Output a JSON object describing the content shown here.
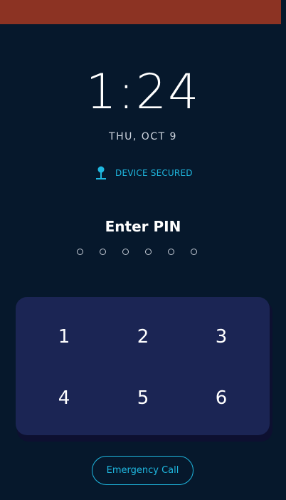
{
  "status_bar": {
    "color": "#8c3323"
  },
  "lock_screen": {
    "time": "1:24",
    "date": "THU, OCT 9",
    "secured_icon": "pin-icon",
    "secured_label": "DEVICE SECURED",
    "prompt": "Enter PIN",
    "pin_length": 6,
    "pin_entered": 0
  },
  "keypad": {
    "keys": [
      "1",
      "2",
      "3",
      "4",
      "5",
      "6"
    ]
  },
  "emergency": {
    "label": "Emergency Call"
  },
  "colors": {
    "background": "#06182c",
    "accent": "#1fb8e0",
    "keypad": "#1b2554",
    "status_bar": "#8c3323"
  }
}
